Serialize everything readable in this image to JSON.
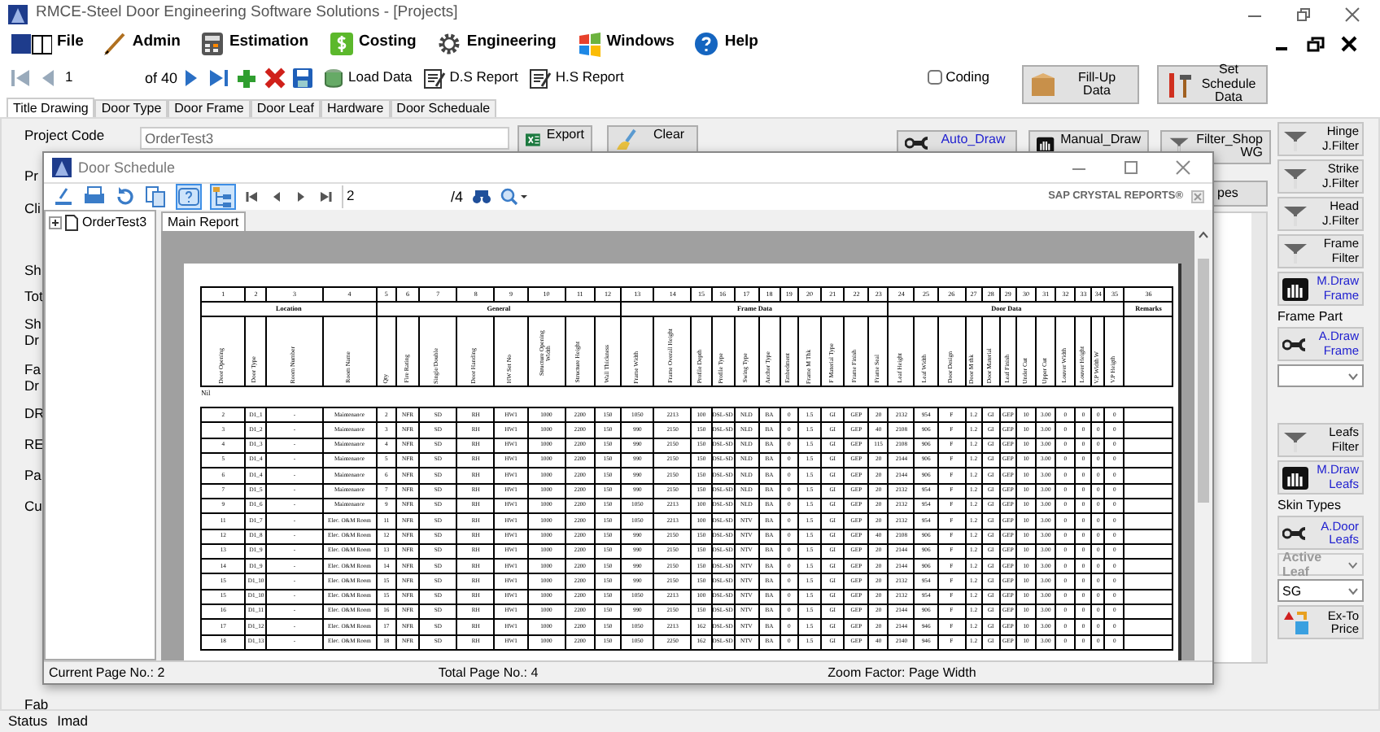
{
  "window": {
    "title": "RMCE-Steel Door Engineering Software Solutions - [Projects]"
  },
  "menu": [
    {
      "label": "File"
    },
    {
      "label": "Admin"
    },
    {
      "label": "Estimation"
    },
    {
      "label": "Costing"
    },
    {
      "label": "Engineering"
    },
    {
      "label": "Windows"
    },
    {
      "label": "Help"
    }
  ],
  "toolbar": {
    "record": "1",
    "record_count": "of 40",
    "buttons": [
      "Load Data",
      "D.S Report",
      "H.S Report"
    ],
    "coding": {
      "label": "Coding",
      "checked": false
    },
    "actions": [
      "Fill-Up Data",
      "Set Schedule Data"
    ]
  },
  "tabs": [
    {
      "label": "Title Drawing",
      "selected": true
    },
    {
      "label": "Door Type",
      "selected": false
    },
    {
      "label": "Door Frame",
      "selected": false
    },
    {
      "label": "Door Leaf",
      "selected": false
    },
    {
      "label": "Hardware",
      "selected": false
    },
    {
      "label": "Door Scheduale",
      "selected": false
    }
  ],
  "form": {
    "project_code_label": "Project Code",
    "project_code": "OrderTest3",
    "export": "Export",
    "clear": "Clear",
    "draw_buttons": [
      {
        "lines": [
          "Auto_Draw"
        ],
        "link": true
      },
      {
        "lines": [
          "Manual_Draw"
        ],
        "link": false
      },
      {
        "lines": [
          "Filter_Shop",
          "WG"
        ],
        "link": false
      }
    ],
    "partial_labels": [
      "Pr",
      "Cli",
      "Sh",
      "Tot",
      "Sh",
      "Dr",
      "Fa",
      "Dr",
      "DR",
      "RE",
      "Pa",
      "Cu",
      "Fab"
    ],
    "types_button": "pes"
  },
  "right_panel": [
    {
      "kind": "button",
      "label": "Hinge J.Filter",
      "link": false
    },
    {
      "kind": "button",
      "label": "Strike J.Filter",
      "link": false
    },
    {
      "kind": "button",
      "label": "Head J.Filter",
      "link": false
    },
    {
      "kind": "button",
      "label": "Frame Filter",
      "link": false
    },
    {
      "kind": "button",
      "label": "M.Draw Frame",
      "link": true
    },
    {
      "kind": "label",
      "label": "Frame Part"
    },
    {
      "kind": "button",
      "label": "A.Draw Frame",
      "link": true
    },
    {
      "kind": "select",
      "disabled": false
    },
    {
      "kind": "button",
      "label": "Leafs Filter",
      "link": false
    },
    {
      "kind": "button",
      "label": "M.Draw Leafs",
      "link": true
    },
    {
      "kind": "label",
      "label": "Skin Types"
    },
    {
      "kind": "button",
      "label": "A.Door Leafs",
      "link": true
    },
    {
      "kind": "select",
      "value": "Active Leaf",
      "disabled": true
    },
    {
      "kind": "select",
      "value": "SG",
      "disabled": false
    },
    {
      "kind": "button",
      "label": "Ex-To Price",
      "link": false
    }
  ],
  "dialog": {
    "title": "Door Schedule",
    "toggles": [
      {
        "selected": true
      },
      {
        "selected": true
      }
    ],
    "page": "2",
    "page_count": "/4",
    "brand": "SAP CRYSTAL REPORTS®",
    "tree": [
      {
        "label": "OrderTest3",
        "expanded": false
      }
    ],
    "report_tab": "Main Report",
    "report": {
      "groups": [
        {
          "label": "Location",
          "columns": [
            {
              "number": "1",
              "title": "Door Opening"
            },
            {
              "number": "2",
              "title": "Door Type"
            },
            {
              "number": "3",
              "title": "Room Number"
            },
            {
              "number": "4",
              "title": "Room Name"
            }
          ]
        },
        {
          "label": "General",
          "columns": [
            {
              "number": "5",
              "title": "Qty"
            },
            {
              "number": "6",
              "title": "Fire Rating"
            },
            {
              "number": "7",
              "title": "Single/Double"
            },
            {
              "number": "8",
              "title": "Door Handing"
            },
            {
              "number": "9",
              "title": "HW Set No"
            },
            {
              "number": "10",
              "title": "Structure Opening Width"
            },
            {
              "number": "11",
              "title": "Structure Height"
            },
            {
              "number": "12",
              "title": "Wall Thickness"
            }
          ]
        },
        {
          "label": "Frame Data",
          "columns": [
            {
              "number": "13",
              "title": "Frame Width"
            },
            {
              "number": "14",
              "title": "Frame Overall Height"
            },
            {
              "number": "15",
              "title": "Profile Depth"
            },
            {
              "number": "16",
              "title": "Profile Type"
            },
            {
              "number": "17",
              "title": "Swing Type"
            },
            {
              "number": "18",
              "title": "Anchor Type"
            },
            {
              "number": "19",
              "title": "Embedment"
            },
            {
              "number": "20",
              "title": "Frame M Thk"
            },
            {
              "number": "21",
              "title": "F Material Type"
            },
            {
              "number": "22",
              "title": "Frame Finish"
            },
            {
              "number": "23",
              "title": "Frame Seal"
            }
          ]
        },
        {
          "label": "Door Data",
          "columns": [
            {
              "number": "24",
              "title": "Leaf Height"
            },
            {
              "number": "25",
              "title": "Leaf Width"
            },
            {
              "number": "26",
              "title": "Door Design"
            },
            {
              "number": "27",
              "title": "Door M thk"
            },
            {
              "number": "28",
              "title": "Door Material"
            },
            {
              "number": "29",
              "title": "Leaf Finish"
            },
            {
              "number": "30",
              "title": "Under Cut"
            },
            {
              "number": "31",
              "title": "Upper Cut"
            },
            {
              "number": "32",
              "title": "Louver Width"
            },
            {
              "number": "33",
              "title": "Louver Height"
            },
            {
              "number": "34",
              "title": "V.P Width W"
            },
            {
              "number": "35",
              "title": "V.P Heigth"
            }
          ]
        },
        {
          "label": "Remarks",
          "columns": [
            {
              "number": "36"
            }
          ]
        }
      ],
      "note": "Nil",
      "rows": [
        [
          "2",
          "D1_1",
          "-",
          "Maintenance",
          "2",
          "NFR",
          "SD",
          "RH",
          "HW1",
          "1000",
          "2200",
          "150",
          "1050",
          "2213",
          "100",
          "DSL-SD",
          "NLD",
          "BA",
          "0",
          "1.5",
          "GI",
          "GEP",
          "20",
          "2132",
          "954",
          "F",
          "1.2",
          "GI",
          "GEP",
          "10",
          "3.00",
          "0",
          "0",
          "0",
          "0"
        ],
        [
          "3",
          "D1_2",
          "-",
          "Maintenance",
          "3",
          "NFR",
          "SD",
          "RH",
          "HW1",
          "1000",
          "2200",
          "150",
          "990",
          "2150",
          "150",
          "DSL-SD",
          "NLD",
          "BA",
          "0",
          "1.5",
          "GI",
          "GEP",
          "40",
          "2108",
          "906",
          "F",
          "1.2",
          "GI",
          "GEP",
          "10",
          "3.00",
          "0",
          "0",
          "0",
          "0"
        ],
        [
          "4",
          "D1_3",
          "-",
          "Maintenance",
          "4",
          "NFR",
          "SD",
          "RH",
          "HW1",
          "1000",
          "2200",
          "150",
          "990",
          "2150",
          "150",
          "DSL-SD",
          "NLD",
          "BA",
          "0",
          "1.5",
          "GI",
          "GEP",
          "115",
          "2108",
          "906",
          "F",
          "1.2",
          "GI",
          "GEP",
          "10",
          "3.00",
          "0",
          "0",
          "0",
          "0"
        ],
        [
          "5",
          "D1_4",
          "-",
          "Maintenance",
          "5",
          "NFR",
          "SD",
          "RH",
          "HW1",
          "1000",
          "2200",
          "150",
          "990",
          "2150",
          "150",
          "DSL-SD",
          "NLD",
          "BA",
          "0",
          "1.5",
          "GI",
          "GEP",
          "20",
          "2144",
          "906",
          "F",
          "1.2",
          "GI",
          "GEP",
          "10",
          "3.00",
          "0",
          "0",
          "0",
          "0"
        ],
        [
          "6",
          "D1_4",
          "-",
          "Maintenance",
          "6",
          "NFR",
          "SD",
          "RH",
          "HW1",
          "1000",
          "2200",
          "150",
          "990",
          "2150",
          "150",
          "DSL-SD",
          "NLD",
          "BA",
          "0",
          "1.5",
          "GI",
          "GEP",
          "20",
          "2144",
          "906",
          "F",
          "1.2",
          "GI",
          "GEP",
          "10",
          "3.00",
          "0",
          "0",
          "0",
          "0"
        ],
        [
          "7",
          "D1_5",
          "-",
          "Maintenance",
          "7",
          "NFR",
          "SD",
          "RH",
          "HW1",
          "1000",
          "2200",
          "150",
          "990",
          "2150",
          "150",
          "DSL-SD",
          "NLD",
          "BA",
          "0",
          "1.5",
          "GI",
          "GEP",
          "20",
          "2132",
          "954",
          "F",
          "1.2",
          "GI",
          "GEP",
          "10",
          "3.00",
          "0",
          "0",
          "0",
          "0"
        ],
        [
          "9",
          "D1_6",
          "-",
          "Maintenance",
          "9",
          "NFR",
          "SD",
          "RH",
          "HW1",
          "1000",
          "2200",
          "150",
          "1050",
          "2213",
          "100",
          "DSL-SD",
          "NLD",
          "BA",
          "0",
          "1.5",
          "GI",
          "GEP",
          "20",
          "2132",
          "954",
          "F",
          "1.2",
          "GI",
          "GEP",
          "10",
          "3.00",
          "0",
          "0",
          "0",
          "0"
        ],
        [
          "11",
          "D1_7",
          "-",
          "Elec. O&M Room",
          "11",
          "NFR",
          "SD",
          "RH",
          "HW1",
          "1000",
          "2200",
          "150",
          "1050",
          "2213",
          "100",
          "DSL-SD",
          "NTV",
          "BA",
          "0",
          "1.5",
          "GI",
          "GEP",
          "20",
          "2132",
          "954",
          "F",
          "1.2",
          "GI",
          "GEP",
          "10",
          "3.00",
          "0",
          "0",
          "0",
          "0"
        ],
        [
          "12",
          "D1_8",
          "-",
          "Elec. O&M Room",
          "12",
          "NFR",
          "SD",
          "RH",
          "HW1",
          "1000",
          "2200",
          "150",
          "990",
          "2150",
          "150",
          "DSL-SD",
          "NTV",
          "BA",
          "0",
          "1.5",
          "GI",
          "GEP",
          "40",
          "2108",
          "906",
          "F",
          "1.2",
          "GI",
          "GEP",
          "10",
          "3.00",
          "0",
          "0",
          "0",
          "0"
        ],
        [
          "13",
          "D1_9",
          "-",
          "Elec. O&M Room",
          "13",
          "NFR",
          "SD",
          "RH",
          "HW1",
          "1000",
          "2200",
          "150",
          "990",
          "2150",
          "150",
          "DSL-SD",
          "NTV",
          "BA",
          "0",
          "1.5",
          "GI",
          "GEP",
          "20",
          "2144",
          "906",
          "F",
          "1.2",
          "GI",
          "GEP",
          "10",
          "3.00",
          "0",
          "0",
          "0",
          "0"
        ],
        [
          "14",
          "D1_9",
          "-",
          "Elec. O&M Room",
          "14",
          "NFR",
          "SD",
          "RH",
          "HW1",
          "1000",
          "2200",
          "150",
          "990",
          "2150",
          "150",
          "DSL-SD",
          "NTV",
          "BA",
          "0",
          "1.5",
          "GI",
          "GEP",
          "20",
          "2144",
          "906",
          "F",
          "1.2",
          "GI",
          "GEP",
          "10",
          "3.00",
          "0",
          "0",
          "0",
          "0"
        ],
        [
          "15",
          "D1_10",
          "-",
          "Elec. O&M Room",
          "15",
          "NFR",
          "SD",
          "RH",
          "HW1",
          "1000",
          "2200",
          "150",
          "990",
          "2150",
          "150",
          "DSL-SD",
          "NTV",
          "BA",
          "0",
          "1.5",
          "GI",
          "GEP",
          "20",
          "2132",
          "954",
          "F",
          "1.2",
          "GI",
          "GEP",
          "10",
          "3.00",
          "0",
          "0",
          "0",
          "0"
        ],
        [
          "15",
          "D1_10",
          "-",
          "Elec. O&M Room",
          "15",
          "NFR",
          "SD",
          "RH",
          "HW1",
          "1000",
          "2200",
          "150",
          "1050",
          "2213",
          "100",
          "DSL-SD",
          "NTV",
          "BA",
          "0",
          "1.5",
          "GI",
          "GEP",
          "20",
          "2132",
          "954",
          "F",
          "1.2",
          "GI",
          "GEP",
          "10",
          "3.00",
          "0",
          "0",
          "0",
          "0"
        ],
        [
          "16",
          "D1_11",
          "-",
          "Elec. O&M Room",
          "16",
          "NFR",
          "SD",
          "RH",
          "HW1",
          "1000",
          "2200",
          "150",
          "990",
          "2150",
          "150",
          "DSL-SD",
          "NTV",
          "BA",
          "0",
          "1.5",
          "GI",
          "GEP",
          "20",
          "2144",
          "906",
          "F",
          "1.2",
          "GI",
          "GEP",
          "10",
          "3.00",
          "0",
          "0",
          "0",
          "0"
        ],
        [
          "17",
          "D1_12",
          "-",
          "Elec. O&M Room",
          "17",
          "NFR",
          "SD",
          "RH",
          "HW1",
          "1000",
          "2200",
          "150",
          "1050",
          "2213",
          "162",
          "DSL-SD",
          "NTV",
          "BA",
          "0",
          "1.5",
          "GI",
          "GEP",
          "20",
          "2144",
          "946",
          "F",
          "1.2",
          "GI",
          "GEP",
          "10",
          "3.00",
          "0",
          "0",
          "0",
          "0"
        ],
        [
          "18",
          "D1_13",
          "-",
          "Elec. O&M Room",
          "18",
          "NFR",
          "SD",
          "RH",
          "HW1",
          "1000",
          "2200",
          "150",
          "1050",
          "2250",
          "162",
          "DSL-SD",
          "NTV",
          "BA",
          "0",
          "1.5",
          "GI",
          "GEP",
          "40",
          "2140",
          "946",
          "F",
          "1.2",
          "GI",
          "GEP",
          "10",
          "3.00",
          "0",
          "0",
          "0",
          "0"
        ]
      ]
    },
    "status": {
      "current_page": "Current Page No.: 2",
      "total_pages": "Total Page No.: 4",
      "zoom": "Zoom Factor: Page Width"
    }
  },
  "status_bar": {
    "label": "Status",
    "user": "Imad"
  }
}
